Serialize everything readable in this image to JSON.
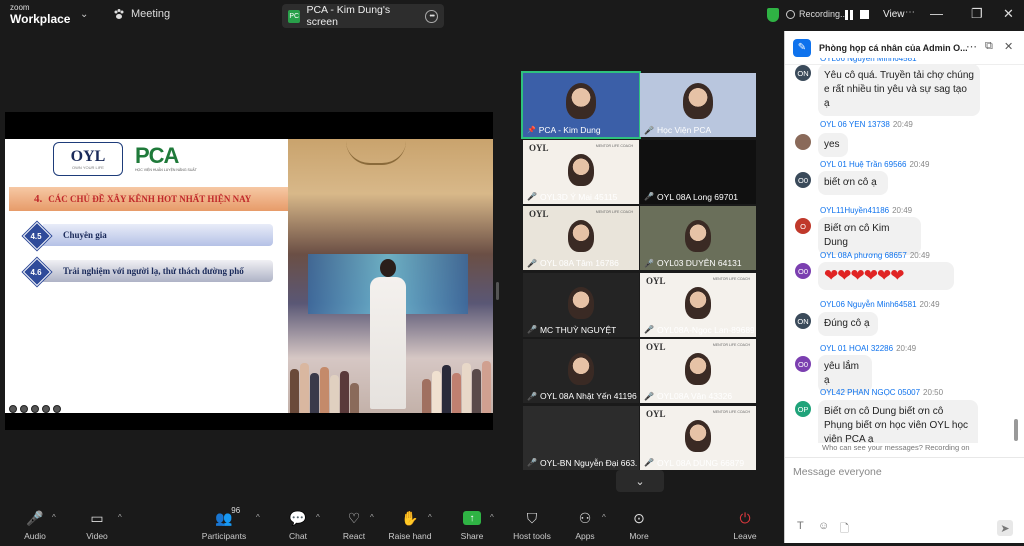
{
  "app": {
    "logo_line1": "zoom",
    "logo_line2": "Workplace",
    "meeting_tab": "Meeting",
    "screen_tab": "PCA - Kim Dung's screen",
    "recording": "Recording...",
    "view": "View"
  },
  "slide": {
    "logo_oyl": "OYL",
    "logo_oyl_sub": "OWN YOUR LIFE",
    "logo_pca": "PCA",
    "logo_pca_sub": "HỌC VIỆN HUẤN LUYỆN NĂNG SUẤT",
    "heading_num": "4.",
    "heading": "CÁC CHỦ ĐỀ XÂY KÊNH HOT NHẤT HIỆN NAY",
    "items": [
      {
        "num": "4.5",
        "text": "Chuyên gia"
      },
      {
        "num": "4.6",
        "text": "Trải nghiệm với người lạ, thử thách đường phố"
      }
    ]
  },
  "gallery": [
    {
      "name": "PCA - Kim Dung",
      "muted": false,
      "pin": true,
      "active": true,
      "bg": "#3b5fa8"
    },
    {
      "name": "Học Viện PCA",
      "muted": true,
      "active": false,
      "bg": "#b9c6de"
    },
    {
      "name": "OYL3D Ý Mai 45115",
      "muted": true,
      "bg": "#f4f0ea"
    },
    {
      "name": "OYL 08A Long 69701",
      "muted": true,
      "bg": "#101010"
    },
    {
      "name": "OYL 08A Tâm 16786",
      "muted": true,
      "bg": "#e9e4da"
    },
    {
      "name": "OYL03 DUYÊN 64131",
      "muted": true,
      "bg": "#6a6f5a"
    },
    {
      "name": "MC THUỲ NGUYỆT",
      "muted": true,
      "bg": "#242424"
    },
    {
      "name": "OYL08A-Ngọc Lan-89689",
      "muted": true,
      "bg": "#f4f1ec"
    },
    {
      "name": "OYL 08A Nhật Yến 41196",
      "muted": true,
      "bg": "#242424"
    },
    {
      "name": "OYL08A Vân 43326",
      "muted": true,
      "bg": "#f4f1ec"
    },
    {
      "name": "OYL-BN Nguyễn Đại 663...",
      "muted": true,
      "bg": "#2c2c2c"
    },
    {
      "name": "OYL 08A DUNG 66879",
      "muted": true,
      "bg": "#f4f1ec"
    }
  ],
  "gallery_mark": {
    "oyl": "OYL",
    "mentor": "MENTOR LIFE COACH"
  },
  "chat": {
    "title": "Phòng họp cá nhân của Admin O...",
    "messages": [
      {
        "sender": "OYL06 Nguyễn Minh64581",
        "time": "",
        "avatar": "ON",
        "avatar_color": "#3a4a5a",
        "text": "Yêu cô quá. Truyền tải chợ chúng e rất nhiều tin yêu và sự sag tạo ạ"
      },
      {
        "sender": "OYL 06 YEN 13738",
        "time": "20:49",
        "avatar": "",
        "avatar_color": "#8a6a5a",
        "text": "yes"
      },
      {
        "sender": "OYL 01 Huệ Trần 69566",
        "time": "20:49",
        "avatar": "O0",
        "avatar_color": "#3a4a5a",
        "text": "biết ơn cô ạ"
      },
      {
        "sender": "OYL11Huyền41186",
        "time": "20:49",
        "avatar": "O",
        "avatar_color": "#c0392b",
        "text": "Biết ơn cô Kim Dung"
      },
      {
        "sender": "OYL 08A phương 68657",
        "time": "20:49",
        "avatar": "O0",
        "avatar_color": "#7b3fb0",
        "text": "❤❤❤❤❤❤"
      },
      {
        "sender": "OYL06 Nguyễn Minh64581",
        "time": "20:49",
        "avatar": "ON",
        "avatar_color": "#3a4a5a",
        "text": "Đúng cô ạ"
      },
      {
        "sender": "OYL 01 HOAI 32286",
        "time": "20:49",
        "avatar": "O0",
        "avatar_color": "#7b3fb0",
        "text": "yêu lắm ạ"
      },
      {
        "sender": "OYL42 PHAN NGỌC 05007",
        "time": "20:50",
        "avatar": "OP",
        "avatar_color": "#1fa37a",
        "text": "Biết ơn cô Dung biết ơn cô Phụng biết ơn học viên OYL học viện PCA ạ"
      }
    ],
    "who_can_see": "Who can see your messages? Recording on",
    "input_placeholder": "Message everyone"
  },
  "toolbar": {
    "audio": "Audio",
    "video": "Video",
    "participants": "Participants",
    "participants_count": "96",
    "chat": "Chat",
    "react": "React",
    "raise_hand": "Raise hand",
    "share": "Share",
    "host_tools": "Host tools",
    "apps": "Apps",
    "more": "More",
    "leave": "Leave"
  }
}
